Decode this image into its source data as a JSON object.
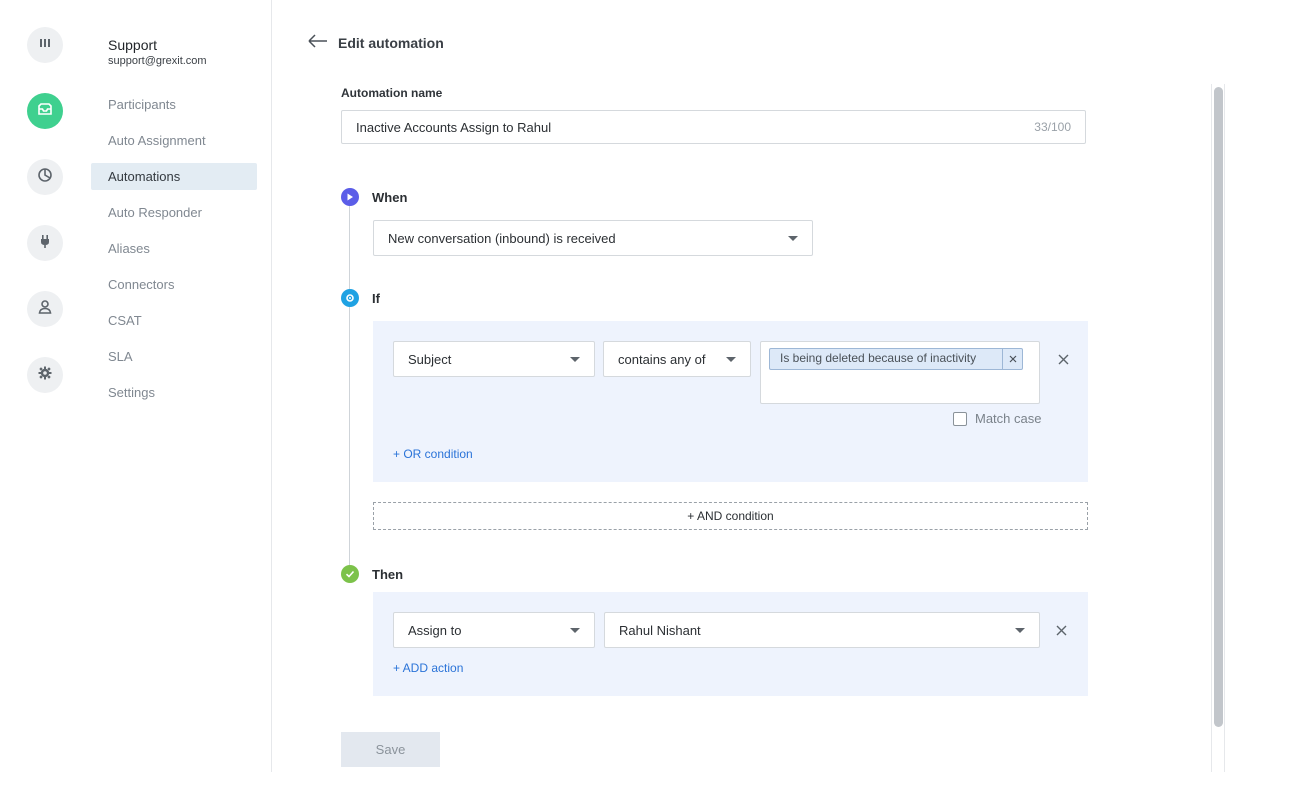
{
  "rail": {
    "items": [
      {
        "icon": "bars-icon"
      },
      {
        "icon": "inbox-icon",
        "active": true
      },
      {
        "icon": "pie-chart-icon"
      },
      {
        "icon": "plug-icon"
      },
      {
        "icon": "user-icon"
      },
      {
        "icon": "gear-icon"
      }
    ],
    "accent_color": "#3fd08f"
  },
  "sidebar": {
    "account_name": "Support",
    "account_email": "support@grexit.com",
    "items": [
      {
        "label": "Participants"
      },
      {
        "label": "Auto Assignment"
      },
      {
        "label": "Automations",
        "active": true
      },
      {
        "label": "Auto Responder"
      },
      {
        "label": "Aliases"
      },
      {
        "label": "Connectors"
      },
      {
        "label": "CSAT"
      },
      {
        "label": "SLA"
      },
      {
        "label": "Settings"
      }
    ]
  },
  "header": {
    "back_icon": "arrow-left-icon",
    "title": "Edit automation"
  },
  "form": {
    "name_label": "Automation name",
    "name_value": "Inactive Accounts Assign to Rahul",
    "name_count": "33/100"
  },
  "when": {
    "label": "When",
    "trigger_value": "New conversation (inbound) is received",
    "icon_color": "#5b5de8"
  },
  "if": {
    "label": "If",
    "field_value": "Subject",
    "operator_value": "contains any of",
    "tag_text": "Is being deleted because of inactivity",
    "match_case_label": "Match case",
    "match_case_checked": false,
    "or_condition_label": "+ OR condition",
    "and_condition_label": "+ AND condition",
    "icon_color": "#1fa2e3"
  },
  "then": {
    "label": "Then",
    "action_value": "Assign to",
    "assignee_value": "Rahul Nishant",
    "add_action_label": "+ ADD action",
    "icon_color": "#7cc24a"
  },
  "save_label": "Save"
}
